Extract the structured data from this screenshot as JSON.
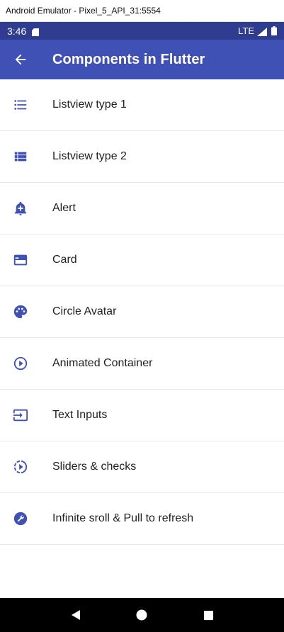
{
  "window": {
    "title": "Android Emulator - Pixel_5_API_31:5554"
  },
  "status_bar": {
    "time": "3:46",
    "network": "LTE"
  },
  "app_bar": {
    "title": "Components in Flutter",
    "back_icon": "arrow-back-icon"
  },
  "items": [
    {
      "label": "Listview type 1",
      "icon": "list-bulleted-icon"
    },
    {
      "label": "Listview type 2",
      "icon": "view-list-icon"
    },
    {
      "label": "Alert",
      "icon": "add-alert-icon"
    },
    {
      "label": "Card",
      "icon": "card-icon"
    },
    {
      "label": "Circle Avatar",
      "icon": "palette-icon"
    },
    {
      "label": "Animated Container",
      "icon": "play-circle-outline-icon"
    },
    {
      "label": "Text Inputs",
      "icon": "input-icon"
    },
    {
      "label": "Sliders & checks",
      "icon": "slow-motion-video-icon"
    },
    {
      "label": "Infinite sroll & Pull to refresh",
      "icon": "wrench-icon"
    }
  ],
  "nav_bar": {
    "back": "triangle-back-icon",
    "home": "circle-home-icon",
    "recents": "square-recents-icon"
  },
  "colors": {
    "primary": "#3f51b5",
    "status_bar": "#2f3c8f",
    "icon": "#3f51b5"
  }
}
